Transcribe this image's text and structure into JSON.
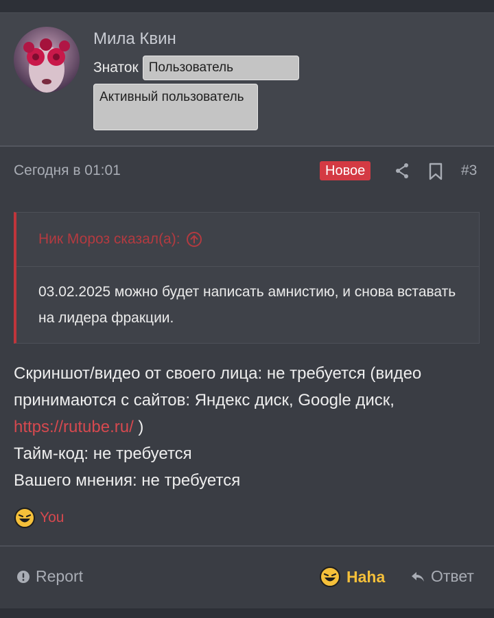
{
  "author": {
    "name": "Мила Квин",
    "rank": "Знаток",
    "badges": [
      "Пользователь",
      "Активный пользователь"
    ]
  },
  "post": {
    "date": "Сегодня в 01:01",
    "new_label": "Новое",
    "number": "#3"
  },
  "quote": {
    "header": "Ник Мороз сказал(а):",
    "text": "03.02.2025 можно будет написать амнистию, и снова вставать на лидера фракции."
  },
  "content": {
    "line1_before_link": "Скриншот/видео от своего лица: не требуется (видео принимаются с сайтов: Яндекс диск, Google диск, ",
    "link": "https://rutube.ru/",
    "line1_after_link": " )",
    "line2": "Тайм-код: не требуется",
    "line3": "Вашего мнения: не требуется"
  },
  "reactions": {
    "you_label": "You"
  },
  "footer": {
    "report_label": "Report",
    "haha_label": "Haha",
    "reply_label": "Ответ"
  },
  "colors": {
    "accent_red": "#d43a43",
    "link_red": "#d6494f",
    "haha_yellow": "#f5c03a"
  }
}
